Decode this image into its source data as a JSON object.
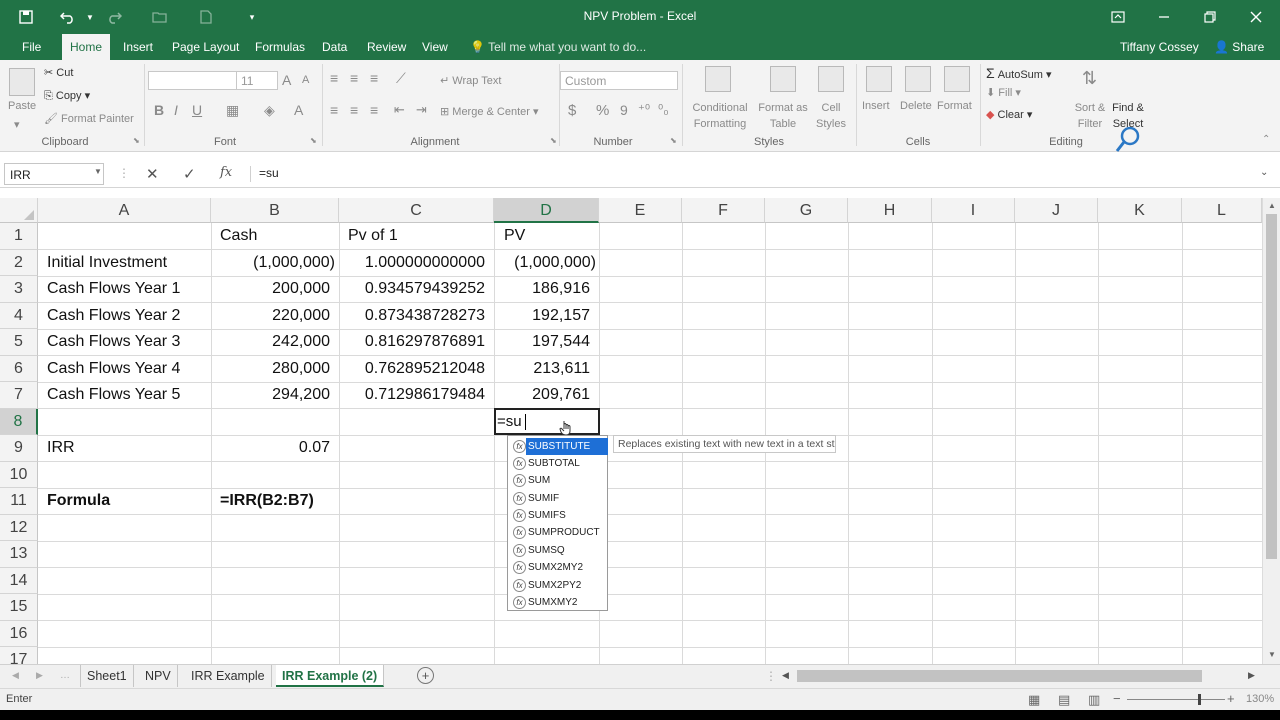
{
  "window": {
    "title": "NPV Problem - Excel",
    "user": "Tiffany Cossey",
    "share": "Share",
    "tell_me": "Tell me what you want to do..."
  },
  "tabs": [
    "File",
    "Home",
    "Insert",
    "Page Layout",
    "Formulas",
    "Data",
    "Review",
    "View"
  ],
  "ribbon": {
    "clipboard": {
      "paste": "Paste",
      "cut": "Cut",
      "copy": "Copy",
      "format_painter": "Format Painter",
      "group": "Clipboard"
    },
    "font": {
      "size": "11",
      "bold": "B",
      "italic": "I",
      "underline": "U",
      "group": "Font"
    },
    "alignment": {
      "wrap_text": "Wrap Text",
      "merge_center": "Merge & Center",
      "group": "Alignment"
    },
    "number": {
      "format": "Custom",
      "currency": "$",
      "percent": "%",
      "comma": "9",
      "group": "Number"
    },
    "styles": {
      "conditional_1": "Conditional",
      "conditional_2": "Formatting",
      "format_as_1": "Format as",
      "format_as_2": "Table",
      "cell_1": "Cell",
      "cell_2": "Styles",
      "group": "Styles"
    },
    "cells": {
      "insert": "Insert",
      "delete": "Delete",
      "format": "Format",
      "group": "Cells"
    },
    "editing": {
      "autosum": "AutoSum",
      "fill": "Fill",
      "clear": "Clear",
      "sort_1": "Sort &",
      "sort_2": "Filter",
      "find_1": "Find &",
      "find_2": "Select",
      "group": "Editing"
    }
  },
  "formula_bar": {
    "name_box": "IRR",
    "formula": "=su",
    "fx": "fx"
  },
  "columns": [
    "A",
    "B",
    "C",
    "D",
    "E",
    "F",
    "G",
    "H",
    "I",
    "J",
    "K",
    "L"
  ],
  "rows": [
    "1",
    "2",
    "3",
    "4",
    "5",
    "6",
    "7",
    "8",
    "9",
    "10",
    "11",
    "12",
    "13",
    "14",
    "15",
    "16",
    "17"
  ],
  "cells": {
    "B1": "Cash",
    "C1": "Pv of 1",
    "D1": "PV",
    "A2": "Initial Investment",
    "B2": "(1,000,000)",
    "C2": "1.000000000000",
    "D2": "(1,000,000)",
    "A3": "Cash Flows Year 1",
    "B3": "200,000",
    "C3": "0.934579439252",
    "D3": "186,916",
    "A4": "Cash Flows Year 2",
    "B4": "220,000",
    "C4": "0.873438728273",
    "D4": "192,157",
    "A5": "Cash Flows Year 3",
    "B5": "242,000",
    "C5": "0.816297876891",
    "D5": "197,544",
    "A6": "Cash Flows Year 4",
    "B6": "280,000",
    "C6": "0.762895212048",
    "D6": "213,611",
    "A7": "Cash Flows Year 5",
    "B7": "294,200",
    "C7": "0.712986179484",
    "D7": "209,761",
    "D8": "=su",
    "A9": "IRR",
    "B9": "0.07",
    "A11": "Formula",
    "B11": "=IRR(B2:B7)"
  },
  "autocomplete": {
    "items": [
      "SUBSTITUTE",
      "SUBTOTAL",
      "SUM",
      "SUMIF",
      "SUMIFS",
      "SUMPRODUCT",
      "SUMSQ",
      "SUMX2MY2",
      "SUMX2PY2",
      "SUMXMY2"
    ],
    "selected": "SUBSTITUTE",
    "tooltip": "Replaces existing text with new text in a text string"
  },
  "sheets": [
    "Sheet1",
    "NPV",
    "IRR Example",
    "IRR Example (2)"
  ],
  "active_sheet": "IRR Example (2)",
  "status": {
    "mode": "Enter",
    "zoom": "130%"
  },
  "colors": {
    "excel_green": "#217346",
    "selection_blue": "#1e6fd6"
  }
}
